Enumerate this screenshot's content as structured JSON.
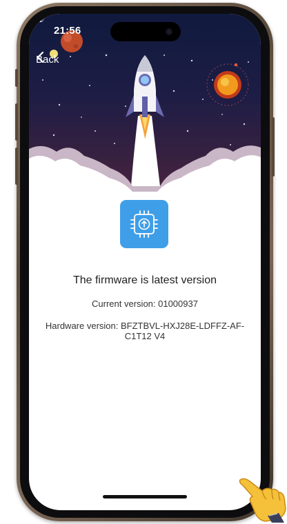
{
  "status_bar": {
    "time": "21:56",
    "location_icon": "location-arrow-icon",
    "signal_icon": "cellular-signal-icon",
    "wifi_icon": "wifi-icon",
    "battery_icon": "battery-icon"
  },
  "nav": {
    "back_label": "Back",
    "back_icon": "chevron-left-icon"
  },
  "header": {
    "illustration": "rocket-launch-illustration"
  },
  "firmware": {
    "icon": "chip-upload-icon",
    "status": "The firmware is latest version",
    "current_version": "Current version: 01000937",
    "hardware_version": "Hardware version: BFZTBVL-HXJ28E-LDFFZ-AF-C1T12 V4"
  },
  "colors": {
    "space_top": "#101a3e",
    "space_bottom": "#4a2340",
    "accent_blue": "#3f9ee8",
    "text_dark": "#1f1f1f",
    "text_body": "#333333"
  }
}
